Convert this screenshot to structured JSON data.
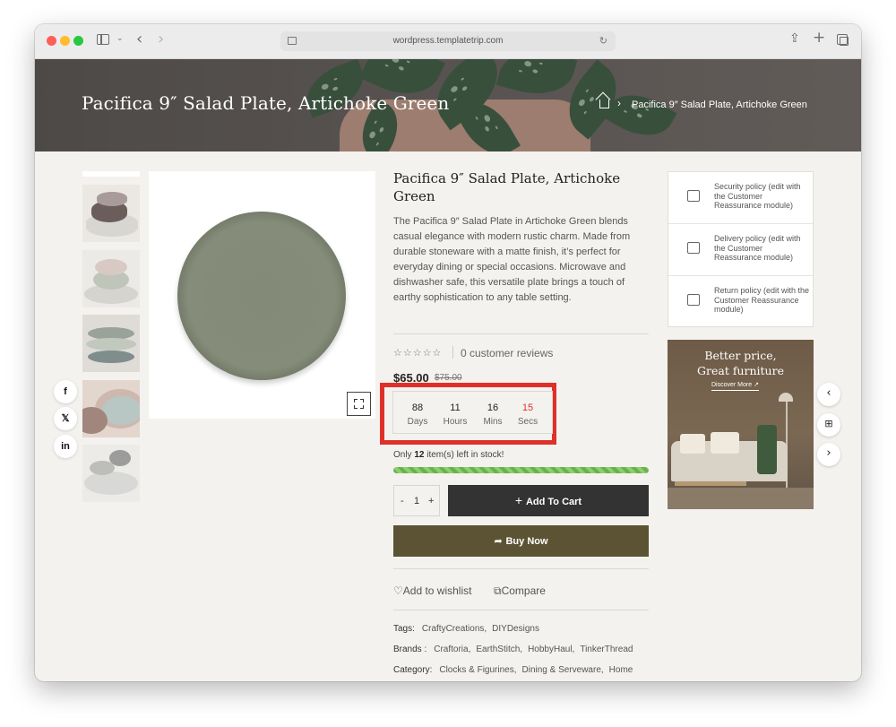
{
  "browser": {
    "url": "wordpress.templatetrip.com"
  },
  "hero": {
    "title": "Pacifica 9″ Salad Plate, Artichoke Green",
    "breadcrumb_current": "Pacifica 9″ Salad Plate, Artichoke Green"
  },
  "product": {
    "title": "Pacifica 9″ Salad Plate, Artichoke Green",
    "description": "The Pacifica 9″ Salad Plate in Artichoke Green blends casual elegance with modern rustic charm. Made from durable stoneware with a matte finish, it’s perfect for everyday dining or special occasions. Microwave and dishwasher safe, this versatile plate brings a touch of earthy sophistication to any table setting.",
    "rating_stars": "☆☆☆☆☆",
    "rating_value": 0,
    "reviews": "0 customer reviews",
    "price": "$65.00",
    "old_price": "$75.00",
    "countdown": {
      "days": "88",
      "days_label": "Days",
      "hours": "11",
      "hours_label": "Hours",
      "mins": "16",
      "mins_label": "Mins",
      "secs": "15",
      "secs_label": "Secs"
    },
    "stock_prefix": "Only",
    "stock_count": "12",
    "stock_suffix": "item(s) left in stock!",
    "qty_minus": "-",
    "qty_value": "1",
    "qty_plus": "+",
    "add_to_cart": "Add To Cart",
    "buy_now": "Buy Now",
    "wishlist": "Add to wishlist",
    "compare": "Compare",
    "tags_label": "Tags:",
    "tags": [
      "CraftyCreations,",
      "DIYDesigns"
    ],
    "brands_label": "Brands :",
    "brands": [
      "Craftoria,",
      "EarthStitch,",
      "HobbyHaul,",
      "TinkerThread"
    ],
    "category_label": "Category:",
    "categories": [
      "Clocks & Figurines,",
      "Dining & Serveware,",
      "Home"
    ]
  },
  "policies": [
    {
      "text": "Security policy (edit with the Customer Reassurance module)",
      "icon": "lock-icon"
    },
    {
      "text": "Delivery policy (edit with the Customer Reassurance module)",
      "icon": "truck-icon"
    },
    {
      "text": "Return policy (edit with the Customer Reassurance module)",
      "icon": "return-icon"
    }
  ],
  "banner": {
    "title_line1": "Better price,",
    "title_line2": "Great furniture",
    "link": "Discover More  ↗"
  },
  "social": [
    "f",
    "𝕏",
    "in"
  ],
  "colors": {
    "countdown_highlight": "#e0302a",
    "buy_now_bg": "#5b5333",
    "add_cart_bg": "#333333",
    "stock_bar": "#67b24f"
  }
}
